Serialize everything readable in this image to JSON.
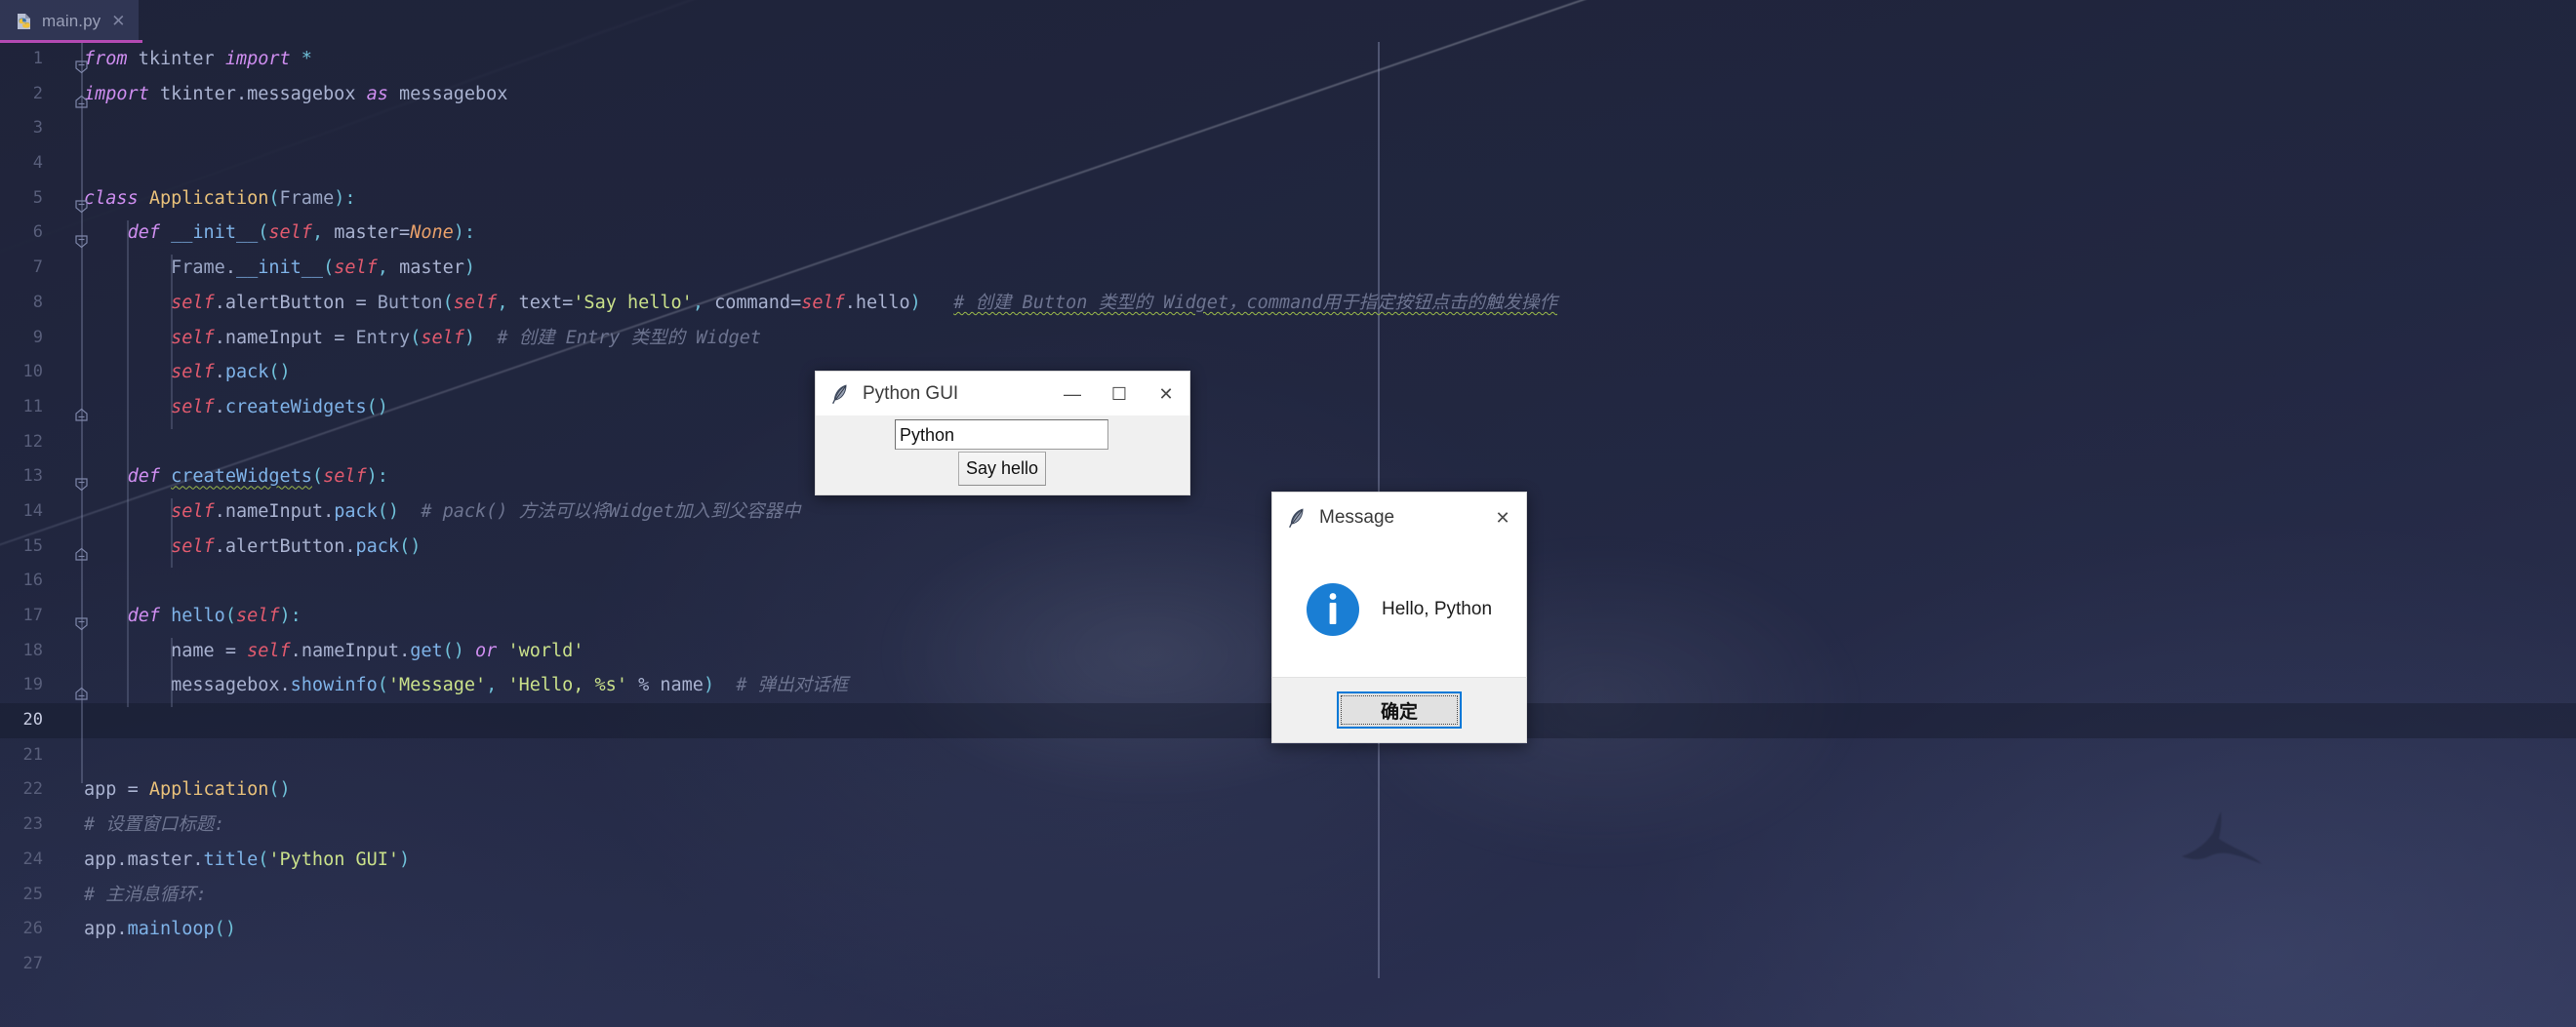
{
  "window": {
    "tab": {
      "filename": "main.py",
      "icon": "python-file-icon",
      "close_label": "✕"
    },
    "accent_underline_color": "#b34ab3",
    "background_color": "#272d4c"
  },
  "editor": {
    "caret_line": 20,
    "total_lines_visible": 27,
    "lines": [
      {
        "n": 1,
        "fold": "open",
        "indent": 0,
        "text": "from tkinter import *"
      },
      {
        "n": 2,
        "fold": "endonly",
        "indent": 0,
        "text": "import tkinter.messagebox as messagebox"
      },
      {
        "n": 3,
        "fold": "none",
        "indent": 0,
        "text": ""
      },
      {
        "n": 4,
        "fold": "none",
        "indent": 0,
        "text": ""
      },
      {
        "n": 5,
        "fold": "open",
        "indent": 0,
        "text": "class Application(Frame):"
      },
      {
        "n": 6,
        "fold": "open",
        "indent": 1,
        "text": "def __init__(self, master=None):"
      },
      {
        "n": 7,
        "fold": "none",
        "indent": 2,
        "text": "Frame.__init__(self, master)"
      },
      {
        "n": 8,
        "fold": "none",
        "indent": 2,
        "text": "self.alertButton = Button(self, text='Say hello', command=self.hello)   # 创建 Button 类型的 Widget，command用于指定按钮点击的触发操作"
      },
      {
        "n": 9,
        "fold": "none",
        "indent": 2,
        "text": "self.nameInput = Entry(self)  # 创建 Entry 类型的 Widget"
      },
      {
        "n": 10,
        "fold": "none",
        "indent": 2,
        "text": "self.pack()"
      },
      {
        "n": 11,
        "fold": "endonly",
        "indent": 2,
        "text": "self.createWidgets()"
      },
      {
        "n": 12,
        "fold": "none",
        "indent": 0,
        "text": ""
      },
      {
        "n": 13,
        "fold": "open",
        "indent": 1,
        "text": "def createWidgets(self):"
      },
      {
        "n": 14,
        "fold": "none",
        "indent": 2,
        "text": "self.nameInput.pack()  # pack() 方法可以将Widget加入到父容器中"
      },
      {
        "n": 15,
        "fold": "endonly",
        "indent": 2,
        "text": "self.alertButton.pack()"
      },
      {
        "n": 16,
        "fold": "none",
        "indent": 0,
        "text": ""
      },
      {
        "n": 17,
        "fold": "open",
        "indent": 1,
        "text": "def hello(self):"
      },
      {
        "n": 18,
        "fold": "none",
        "indent": 2,
        "text": "name = self.nameInput.get() or 'world'"
      },
      {
        "n": 19,
        "fold": "endonly",
        "indent": 2,
        "text": "messagebox.showinfo('Message', 'Hello, %s' % name)  # 弹出对话框"
      },
      {
        "n": 20,
        "fold": "none",
        "indent": 0,
        "text": ""
      },
      {
        "n": 21,
        "fold": "none",
        "indent": 0,
        "text": ""
      },
      {
        "n": 22,
        "fold": "none",
        "indent": 0,
        "text": "app = Application()"
      },
      {
        "n": 23,
        "fold": "none",
        "indent": 0,
        "text": "# 设置窗口标题:"
      },
      {
        "n": 24,
        "fold": "none",
        "indent": 0,
        "text": "app.master.title('Python GUI')"
      },
      {
        "n": 25,
        "fold": "none",
        "indent": 0,
        "text": "# 主消息循环:"
      },
      {
        "n": 26,
        "fold": "none",
        "indent": 0,
        "text": "app.mainloop()"
      },
      {
        "n": 27,
        "fold": "none",
        "indent": 0,
        "text": ""
      }
    ],
    "comments": {
      "line8": "# 创建 Button 类型的 Widget，command用于指定按钮点击的触发操作",
      "line9": "# 创建 Entry 类型的 Widget",
      "line14": "# pack() 方法可以将Widget加入到父容器中",
      "line19": "# 弹出对话框",
      "line23": "# 设置窗口标题:",
      "line25": "# 主消息循环:"
    },
    "colors": {
      "keyword": "#cf8ef0",
      "class_name": "#e8c07a",
      "self": "#e05a6e",
      "string": "#c9e08a",
      "function": "#7fb3e8",
      "comment": "#6d7490",
      "punct": "#6fc0d8",
      "warning_squiggle": "#9ab84a"
    }
  },
  "python_gui_window": {
    "title": "Python GUI",
    "icon": "python-feather-icon",
    "minimize_label": "—",
    "maximize_label": "☐",
    "close_label": "✕",
    "entry_value": "Python",
    "entry_placeholder": "",
    "button_label": "Say hello"
  },
  "message_dialog": {
    "title": "Message",
    "icon": "python-feather-icon",
    "close_label": "✕",
    "severity_icon": "info-icon",
    "severity_color": "#1a7ed4",
    "message": "Hello, Python",
    "ok_label": "确定"
  }
}
